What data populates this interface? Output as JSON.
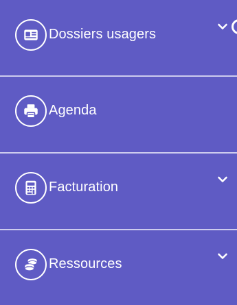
{
  "sidebar": {
    "items": [
      {
        "label": "Dossiers usagers",
        "icon": "id-card-icon",
        "has_chevron": true
      },
      {
        "label": "Agenda",
        "icon": "printer-icon",
        "has_chevron": false
      },
      {
        "label": "Facturation",
        "icon": "calculator-icon",
        "has_chevron": true
      },
      {
        "label": "Ressources",
        "icon": "coins-icon",
        "has_chevron": true
      }
    ]
  },
  "colors": {
    "background": "#5f5bc4",
    "foreground": "#ffffff",
    "divider": "#d9d8f3"
  }
}
